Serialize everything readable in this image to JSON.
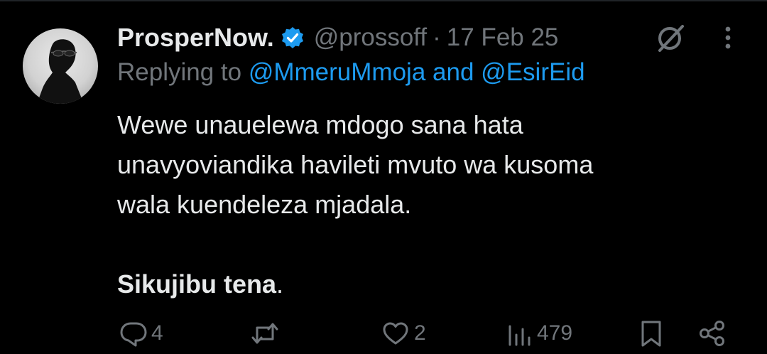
{
  "tweet": {
    "display_name": "ProsperNow.",
    "handle": "@prossoff",
    "separator": "·",
    "date": "17 Feb 25",
    "reply": {
      "prefix": "Replying to",
      "user1": "@MmeruMmoja",
      "joiner": "and",
      "user2": "@EsirEid"
    },
    "body": {
      "line1": "Wewe unauelewa mdogo sana hata",
      "line2": "unavyoviandika havileti mvuto wa kusoma",
      "line3": "wala kuendeleza mjadala.",
      "bold_line": "Sikujibu tena",
      "bold_suffix": "."
    },
    "actions": {
      "replies": "4",
      "reposts": "",
      "likes": "2",
      "views": "479"
    }
  },
  "icons": {
    "verified": "verified-badge-icon",
    "grok": "grok-icon",
    "more": "more-dots-icon",
    "reply": "reply-icon",
    "repost": "repost-icon",
    "like": "heart-icon",
    "views": "views-icon",
    "bookmark": "bookmark-icon",
    "share": "share-icon"
  },
  "colors": {
    "background": "#000000",
    "text": "#e7e9ea",
    "muted": "#71767b",
    "accent": "#1d9bf0"
  }
}
